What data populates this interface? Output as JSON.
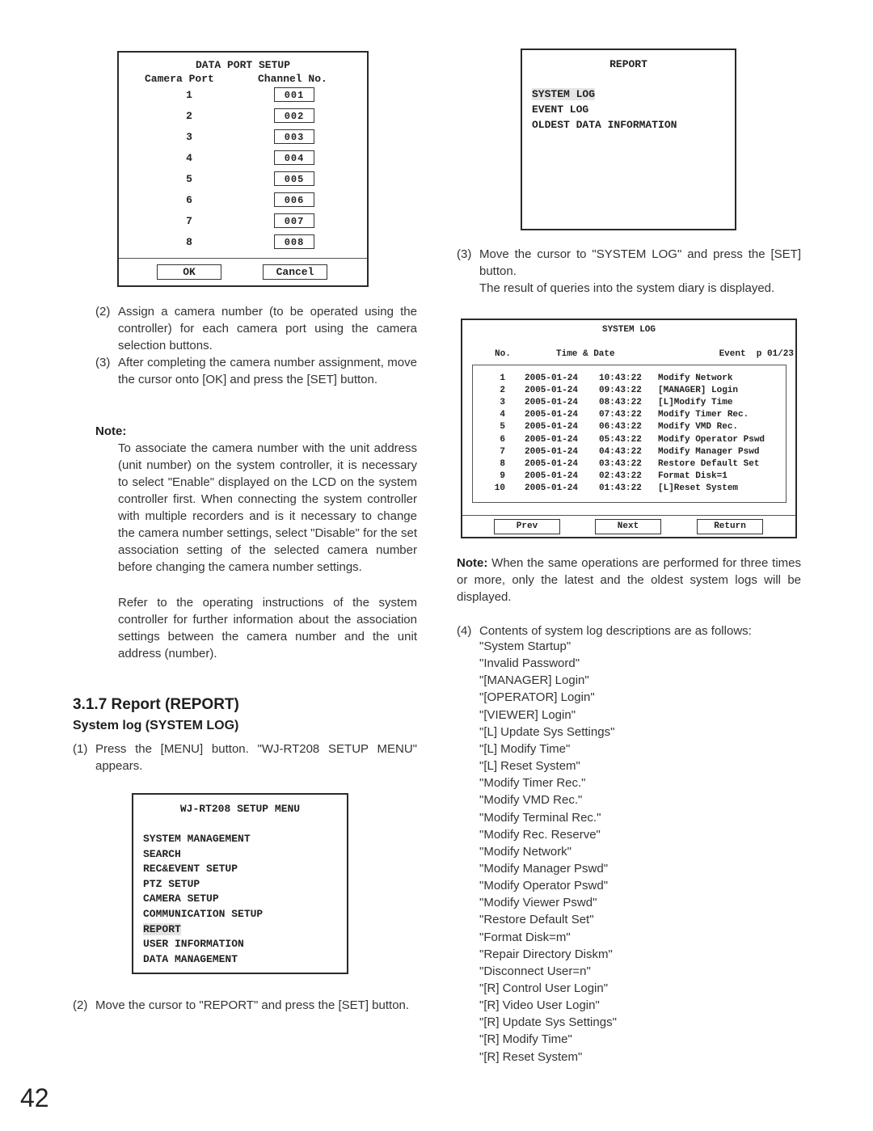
{
  "data_port_setup": {
    "title": "DATA PORT SETUP",
    "col_port": "Camera Port",
    "col_channel": "Channel No.",
    "rows": [
      {
        "port": "1",
        "channel": "001"
      },
      {
        "port": "2",
        "channel": "002"
      },
      {
        "port": "3",
        "channel": "003"
      },
      {
        "port": "4",
        "channel": "004"
      },
      {
        "port": "5",
        "channel": "005"
      },
      {
        "port": "6",
        "channel": "006"
      },
      {
        "port": "7",
        "channel": "007"
      },
      {
        "port": "8",
        "channel": "008"
      }
    ],
    "ok_label": "OK",
    "cancel_label": "Cancel"
  },
  "left_steps": {
    "step2_num": "(2)",
    "step2_text": "Assign a camera number (to be operated using the controller) for each camera port using the camera selection buttons.",
    "step3_num": "(3)",
    "step3_text": "After completing the camera number assignment, move the cursor onto [OK] and press the [SET] button.",
    "note_label": "Note:",
    "note_p1": "To associate the camera number with the unit address (unit number) on the system controller, it is necessary to select \"Enable\" displayed on the LCD on the system controller first. When connecting the system controller with multiple recorders and is it necessary to change the camera number settings, select \"Disable\" for the set association setting of the selected camera number before changing the camera number settings.",
    "note_p2": "Refer to the operating instructions of the system controller for further information about the association settings between the camera number and the unit address (number)."
  },
  "section": {
    "heading": "3.1.7 Report (REPORT)",
    "subheading": "System log (SYSTEM LOG)",
    "step1_num": "(1)",
    "step1_text": "Press the [MENU] button. \"WJ-RT208 SETUP MENU\" appears.",
    "step2_num": "(2)",
    "step2_text": "Move the cursor to \"REPORT\" and press the [SET] button."
  },
  "setup_menu": {
    "title": "WJ-RT208 SETUP MENU",
    "items": [
      "SYSTEM MANAGEMENT",
      "SEARCH",
      "REC&EVENT SETUP",
      "PTZ SETUP",
      "CAMERA SETUP",
      "COMMUNICATION SETUP",
      "REPORT",
      "USER INFORMATION",
      "DATA MANAGEMENT"
    ],
    "selected": "REPORT"
  },
  "report_menu": {
    "title": "REPORT",
    "items": [
      "SYSTEM LOG",
      "EVENT LOG",
      "OLDEST DATA INFORMATION"
    ],
    "selected": "SYSTEM LOG"
  },
  "right_steps": {
    "step3_num": "(3)",
    "step3_text": "Move the cursor to \"SYSTEM LOG\" and press the [SET] button.",
    "step3_result": "The result of queries into the system diary is displayed.",
    "note_label": "Note:",
    "note_text": "When the same operations are performed for three times or more, only the latest and the oldest system logs will be displayed.",
    "step4_num": "(4)",
    "step4_text": "Contents of system log descriptions are as follows:"
  },
  "system_log": {
    "title": "SYSTEM LOG",
    "col_no": "No.",
    "col_time_date": "Time & Date",
    "col_event": "Event",
    "page": "p 01/23",
    "rows": [
      {
        "no": "1",
        "date": "2005-01-24",
        "time": "10:43:22",
        "event": "Modify Network"
      },
      {
        "no": "2",
        "date": "2005-01-24",
        "time": "09:43:22",
        "event": "[MANAGER] Login"
      },
      {
        "no": "3",
        "date": "2005-01-24",
        "time": "08:43:22",
        "event": "[L]Modify Time"
      },
      {
        "no": "4",
        "date": "2005-01-24",
        "time": "07:43:22",
        "event": "Modify Timer Rec."
      },
      {
        "no": "5",
        "date": "2005-01-24",
        "time": "06:43:22",
        "event": "Modify VMD Rec."
      },
      {
        "no": "6",
        "date": "2005-01-24",
        "time": "05:43:22",
        "event": "Modify Operator Pswd"
      },
      {
        "no": "7",
        "date": "2005-01-24",
        "time": "04:43:22",
        "event": "Modify Manager Pswd"
      },
      {
        "no": "8",
        "date": "2005-01-24",
        "time": "03:43:22",
        "event": "Restore Default Set"
      },
      {
        "no": "9",
        "date": "2005-01-24",
        "time": "02:43:22",
        "event": "Format Disk=1"
      },
      {
        "no": "10",
        "date": "2005-01-24",
        "time": "01:43:22",
        "event": "[L]Reset System"
      }
    ],
    "prev_label": "Prev",
    "next_label": "Next",
    "return_label": "Return"
  },
  "log_descriptions": [
    "\"System Startup\"",
    "\"Invalid Password\"",
    "\"[MANAGER] Login\"",
    "\"[OPERATOR] Login\"",
    "\"[VIEWER] Login\"",
    "\"[L] Update Sys Settings\"",
    "\"[L] Modify Time\"",
    "\"[L] Reset System\"",
    "\"Modify Timer Rec.\"",
    "\"Modify VMD Rec.\"",
    "\"Modify Terminal Rec.\"",
    "\"Modify Rec. Reserve\"",
    "\"Modify Network\"",
    "\"Modify Manager Pswd\"",
    "\"Modify Operator Pswd\"",
    "\"Modify Viewer Pswd\"",
    "\"Restore Default Set\"",
    "\"Format Disk=m\"",
    "\"Repair Directory Diskm\"",
    "\"Disconnect User=n\"",
    "\"[R] Control User Login\"",
    "\"[R] Video User Login\"",
    "\"[R] Update Sys Settings\"",
    "\"[R] Modify Time\"",
    "\"[R] Reset System\""
  ],
  "page_number": "42"
}
